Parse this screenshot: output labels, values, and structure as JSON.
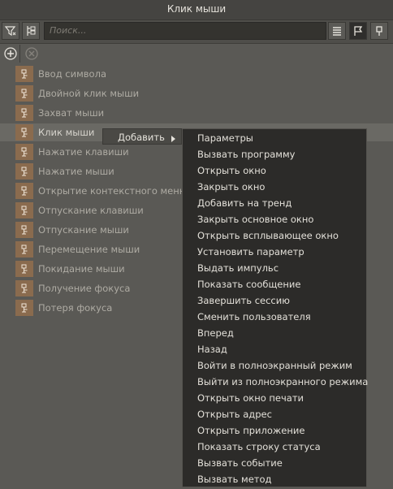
{
  "window": {
    "title": "Клик мыши"
  },
  "search": {
    "placeholder": "Поиск..."
  },
  "tree": {
    "items": [
      {
        "label": "Ввод символа"
      },
      {
        "label": "Двойной клик мыши"
      },
      {
        "label": "Захват мыши"
      },
      {
        "label": "Клик мыши",
        "selected": true
      },
      {
        "label": "Нажатие клавиши"
      },
      {
        "label": "Нажатие мыши"
      },
      {
        "label": "Открытие контекстного меню"
      },
      {
        "label": "Отпускание клавиши"
      },
      {
        "label": "Отпускание мыши"
      },
      {
        "label": "Перемещение мыши"
      },
      {
        "label": "Покидание мыши"
      },
      {
        "label": "Получение фокуса"
      },
      {
        "label": "Потеря фокуса"
      }
    ]
  },
  "context_menu": {
    "add_label": "Добавить",
    "items": [
      "Параметры",
      "Вызвать программу",
      "Открыть окно",
      "Закрыть окно",
      "Добавить на тренд",
      "Закрыть основное окно",
      "Открыть всплывающее окно",
      "Установить параметр",
      "Выдать импульс",
      "Показать сообщение",
      "Завершить сессию",
      "Сменить пользователя",
      "Вперед",
      "Назад",
      "Войти в полноэкранный режим",
      "Выйти из полноэкранного режима",
      "Открыть окно печати",
      "Открыть адрес",
      "Открыть приложение",
      "Показать строку статуса",
      "Вызвать событие",
      "Вызвать метод"
    ]
  }
}
